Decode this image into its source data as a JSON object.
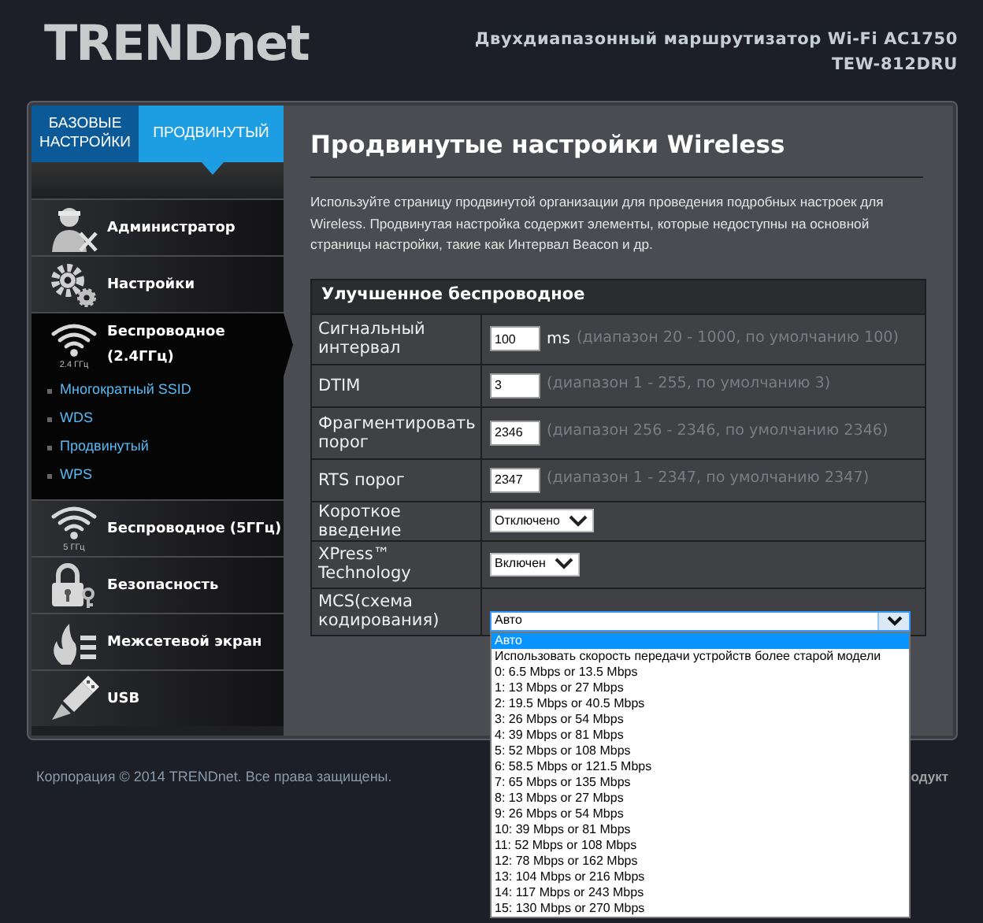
{
  "header": {
    "logo": "TRENDnet",
    "title": "Двухдиапазонный маршрутизатор Wi-Fi AC1750",
    "model": "TEW-812DRU"
  },
  "tabs": [
    {
      "label": "БАЗОВЫЕ НАСТРОЙКИ",
      "selected": false
    },
    {
      "label": "ПРОДВИНУТЫЙ",
      "selected": true
    }
  ],
  "sidebar": {
    "items": [
      {
        "label": "Администратор",
        "expanded": false
      },
      {
        "label": "Настройки",
        "expanded": false
      },
      {
        "label": "Беспроводное (2.4ГГц)",
        "icon_label": "2.4 ГГц",
        "expanded": true,
        "children": [
          {
            "label": "Многократный SSID"
          },
          {
            "label": "WDS"
          },
          {
            "label": "Продвинутый"
          },
          {
            "label": "WPS"
          }
        ]
      },
      {
        "label": "Беспроводное (5ГГц)",
        "icon_label": "5 ГГц",
        "expanded": false
      },
      {
        "label": "Безопасность",
        "expanded": false
      },
      {
        "label": "Межсетевой экран",
        "expanded": false
      },
      {
        "label": "USB",
        "expanded": false
      }
    ]
  },
  "content": {
    "title": "Продвинутые настройки Wireless",
    "description": "Используйте страницу продвинутой организации для проведения подробных настроек для Wireless. Продвинутая настройка содержит элементы, которые недоступны на основной страницы настройки, такие как Интервал Beacon и др.",
    "table": {
      "title": "Улучшенное беспроводное",
      "rows": [
        {
          "kind": "input",
          "label": "Сигнальный интервал",
          "value": "100",
          "unit": "ms",
          "hint": "(диапазон 20 - 1000, по умолчанию 100)"
        },
        {
          "kind": "input",
          "label": "DTIM",
          "value": "3",
          "hint": "(диапазон 1 - 255, по умолчанию 3)"
        },
        {
          "kind": "input",
          "label": "Фрагментировать порог",
          "value": "2346",
          "hint": "(диапазон 256 - 2346, по умолчанию 2346)"
        },
        {
          "kind": "input",
          "label": "RTS порог",
          "value": "2347",
          "hint": "(диапазон 1 - 2347, по умолчанию 2347)"
        },
        {
          "kind": "select",
          "label": "Короткое введение",
          "value": "Отключено"
        },
        {
          "kind": "select",
          "label": "XPress™ Technology",
          "value": "Включен"
        },
        {
          "kind": "dropdown",
          "label": "MCS(схема кодирования)",
          "value": "Авто",
          "expanded": true,
          "options": [
            {
              "label": "Авто",
              "selected": true
            },
            {
              "label": "Использовать скорость передачи устройств более старой модели",
              "selected": false
            },
            {
              "label": "0: 6.5 Mbps or 13.5 Mbps",
              "selected": false
            },
            {
              "label": "1: 13 Mbps or 27 Mbps",
              "selected": false
            },
            {
              "label": "2: 19.5 Mbps or 40.5 Mbps",
              "selected": false
            },
            {
              "label": "3: 26 Mbps or 54 Mbps",
              "selected": false
            },
            {
              "label": "4: 39 Mbps or 81 Mbps",
              "selected": false
            },
            {
              "label": "5: 52 Mbps or 108 Mbps",
              "selected": false
            },
            {
              "label": "6: 58.5 Mbps or 121.5 Mbps",
              "selected": false
            },
            {
              "label": "7: 65 Mbps or 135 Mbps",
              "selected": false
            },
            {
              "label": "8: 13 Mbps or 27 Mbps",
              "selected": false
            },
            {
              "label": "9: 26 Mbps or 54 Mbps",
              "selected": false
            },
            {
              "label": "10: 39 Mbps or 81 Mbps",
              "selected": false
            },
            {
              "label": "11: 52 Mbps or 108 Mbps",
              "selected": false
            },
            {
              "label": "12: 78 Mbps or 162 Mbps",
              "selected": false
            },
            {
              "label": "13: 104 Mbps or 216 Mbps",
              "selected": false
            },
            {
              "label": "14: 117 Mbps or 243 Mbps",
              "selected": false
            },
            {
              "label": "15: 130 Mbps or 270 Mbps",
              "selected": false
            }
          ]
        }
      ]
    }
  },
  "footer": {
    "copyright": "Корпорация © 2014 TRENDnet. Все права защищены.",
    "right_text": "одукт"
  }
}
